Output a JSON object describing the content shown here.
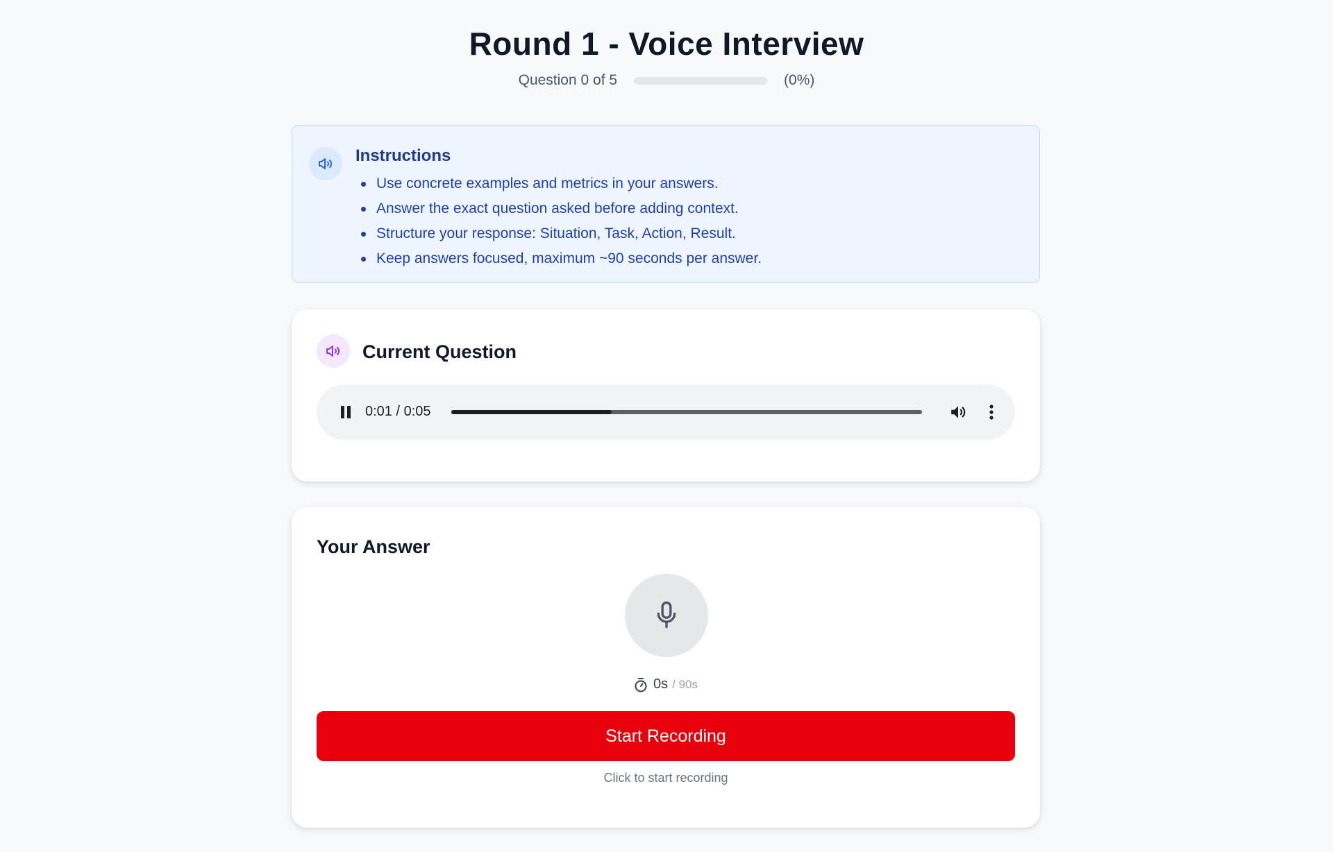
{
  "header": {
    "title": "Round 1 - Voice Interview",
    "progress_text": "Question 0 of 5",
    "progress_percent_text": "(0%)",
    "progress_value": 0
  },
  "instructions": {
    "icon": "speaker-icon",
    "title": "Instructions",
    "items": [
      "Use concrete examples and metrics in your answers.",
      "Answer the exact question asked before adding context.",
      "Structure your response: Situation, Task, Action, Result.",
      "Keep answers focused, maximum ~90 seconds per answer."
    ]
  },
  "question": {
    "icon": "speaker-icon",
    "title": "Current Question",
    "audio": {
      "state": "playing",
      "time_display": "0:01 / 0:05",
      "progress_fraction": 0.34
    }
  },
  "answer": {
    "title": "Your Answer",
    "mic_icon": "microphone-icon",
    "timer_icon": "stopwatch-icon",
    "elapsed": "0s",
    "limit": "/ 90s",
    "button_label": "Start Recording",
    "hint": "Click to start recording"
  },
  "colors": {
    "record_button": "#e7000b",
    "instructions_bg": "#eef5ff",
    "instructions_text": "#1e40af",
    "question_icon_accent": "#9333ea"
  }
}
